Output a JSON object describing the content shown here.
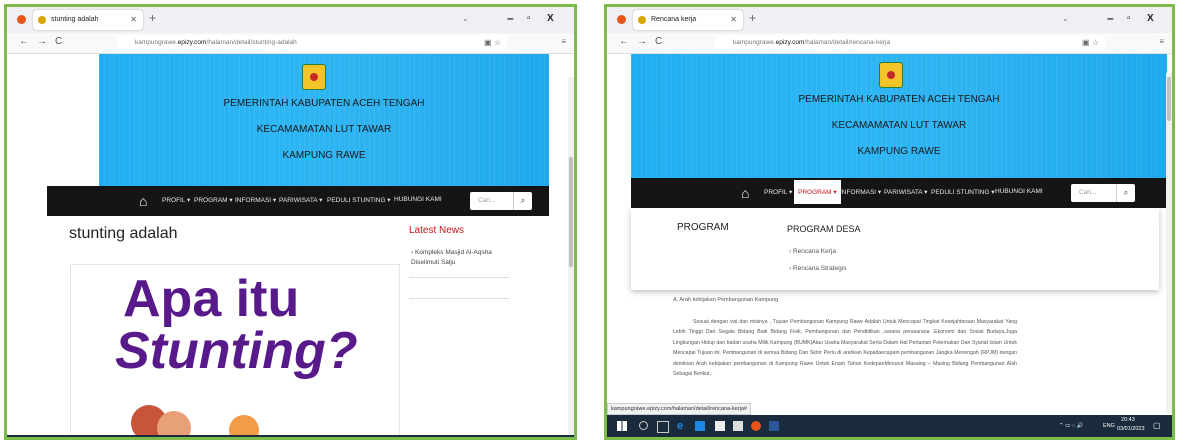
{
  "left": {
    "tab_title": "stunting adalah",
    "url_host": "kampungrawe.epizy.com",
    "url_path": "/halaman/detail/stunting-adalah",
    "url_prefix": "kampungrawe.",
    "url_domain": "epizy.com",
    "banner_line1": "PEMERINTAH KABUPATEN ACEH TENGAH",
    "banner_line2": "KECAMAMATAN LUT TAWAR",
    "banner_line3": "KAMPUNG RAWE",
    "menu": [
      "PROFIL ▾",
      "PROGRAM ▾",
      "INFORMASI ▾",
      "PARIWISATA ▾",
      "PEDULI STUNTING ▾",
      "HUBUNGI KAMI"
    ],
    "search_placeholder": "Cari...",
    "page_title": "stunting adalah",
    "latest_title": "Latest News",
    "news_item": "› Kompleks Masjid Al-Aqsha Diselimuti Salju",
    "image_line1": "Apa itu",
    "image_line2": "Stunting?"
  },
  "right": {
    "tab_title": "Rencana kerja",
    "url_prefix": "kampungrawe.",
    "url_domain": "epizy.com",
    "url_path": "/halaman/detail/rencana-kerja",
    "banner_line1": "PEMERINTAH KABUPATEN ACEH TENGAH",
    "banner_line2": "KECAMAMATAN LUT TAWAR",
    "banner_line3": "KAMPUNG RAWE",
    "menu": [
      "PROFIL ▾",
      "PROGRAM ▾",
      "INFORMASI ▾",
      "PARIWISATA ▾",
      "PEDULI STUNTING ▾",
      "HUBUNGI KAMI"
    ],
    "search_placeholder": "Cari...",
    "dropdown_left": "PROGRAM",
    "dropdown_right": "PROGRAM DESA",
    "dropdown_link1": "› Rencana Kerja",
    "dropdown_link2": "› Rencana Strategis",
    "section": "A.  Arah kebijakan Pembangunan Kampung",
    "paragraph": "Sesuai dengan visi dan misinya , Tujuan Pembangunan Kampung Rawe Adalah Untuk Mencapai Tingkat Kesejahteraan Masyarakat Yang Lebih Tinggi Dari Segala Bidang Baik Bidang Fisik, Pembangunan dan Pendidikan ,sarana perasarana ,Ekonomi dan Sosial Budaya,Juga Lingkungan Hidup dan badan usaha Milik Kampung (BUMK)Atau Usaha Masyarakat Serta Dalam Hal Pertanian Peternakan Dan Syariat Islam Untuk Mencapai Tujuan ini. Pembangunan di semua Bidang Dan Sktor Perlu di arahkan Kepadaecapain pembangunan Jangka Menengah (RPJM) dengan demikian Arah kebijakan pembangunan di Kampung Rawe Untuk Enam Tahun KedepanMenurut Masaing – Masing Bidang Pembangunan Alah Sebagai Berikut,:",
    "status_url": "kampungrawe.epizy.com/halaman/detail/rencana-kerja#",
    "tray_lang": "ENG",
    "tray_time": "20:43",
    "tray_date": "03/01/2023"
  }
}
